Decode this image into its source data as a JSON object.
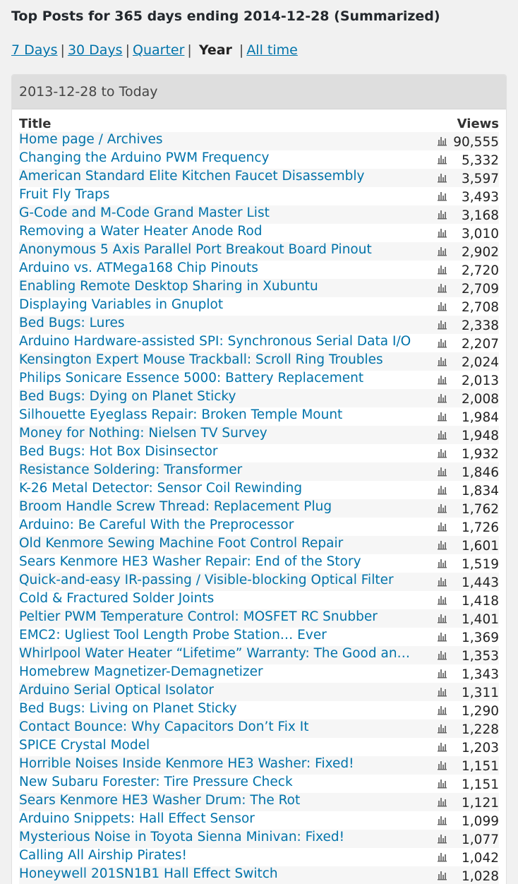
{
  "page_title": "Top Posts for 365 days ending 2014-12-28 (Summarized)",
  "period_nav": {
    "links": [
      "7 Days",
      "30 Days",
      "Quarter"
    ],
    "current": "Year",
    "all_time": "All time",
    "separator": "|"
  },
  "box": {
    "header": "2013-12-28 to Today",
    "col_title": "Title",
    "col_views": "Views"
  },
  "icons": {
    "stats": "bar-chart-icon"
  },
  "colors": {
    "link": "#0073aa",
    "header_bg": "#dedede",
    "row_alt": "#f6f6f6"
  },
  "posts": [
    {
      "title": "Home page / Archives",
      "views": "90,555"
    },
    {
      "title": "Changing the Arduino PWM Frequency",
      "views": "5,332"
    },
    {
      "title": "American Standard Elite Kitchen Faucet Disassembly",
      "views": "3,597"
    },
    {
      "title": "Fruit Fly Traps",
      "views": "3,493"
    },
    {
      "title": "G-Code and M-Code Grand Master List",
      "views": "3,168"
    },
    {
      "title": "Removing a Water Heater Anode Rod",
      "views": "3,010"
    },
    {
      "title": "Anonymous 5 Axis Parallel Port Breakout Board Pinout",
      "views": "2,902"
    },
    {
      "title": "Arduino vs. ATMega168 Chip Pinouts",
      "views": "2,720"
    },
    {
      "title": "Enabling Remote Desktop Sharing in Xubuntu",
      "views": "2,709"
    },
    {
      "title": "Displaying Variables in Gnuplot",
      "views": "2,708"
    },
    {
      "title": "Bed Bugs: Lures",
      "views": "2,338"
    },
    {
      "title": "Arduino Hardware-assisted SPI: Synchronous Serial Data I/O",
      "views": "2,207"
    },
    {
      "title": "Kensington Expert Mouse Trackball: Scroll Ring Troubles",
      "views": "2,024"
    },
    {
      "title": "Philips Sonicare Essence 5000: Battery Replacement",
      "views": "2,013"
    },
    {
      "title": "Bed Bugs: Dying on Planet Sticky",
      "views": "2,008"
    },
    {
      "title": "Silhouette Eyeglass Repair: Broken Temple Mount",
      "views": "1,984"
    },
    {
      "title": "Money for Nothing: Nielsen TV Survey",
      "views": "1,948"
    },
    {
      "title": "Bed Bugs: Hot Box Disinsector",
      "views": "1,932"
    },
    {
      "title": "Resistance Soldering: Transformer",
      "views": "1,846"
    },
    {
      "title": "K-26 Metal Detector: Sensor Coil Rewinding",
      "views": "1,834"
    },
    {
      "title": "Broom Handle Screw Thread: Replacement Plug",
      "views": "1,762"
    },
    {
      "title": "Arduino: Be Careful With the Preprocessor",
      "views": "1,726"
    },
    {
      "title": "Old Kenmore Sewing Machine Foot Control Repair",
      "views": "1,601"
    },
    {
      "title": "Sears Kenmore HE3 Washer Repair: End of the Story",
      "views": "1,519"
    },
    {
      "title": "Quick-and-easy IR-passing / Visible-blocking Optical Filter",
      "views": "1,443"
    },
    {
      "title": "Cold & Fractured Solder Joints",
      "views": "1,418"
    },
    {
      "title": "Peltier PWM Temperature Control: MOSFET RC Snubber",
      "views": "1,401"
    },
    {
      "title": "EMC2: Ugliest Tool Length Probe Station… Ever",
      "views": "1,369"
    },
    {
      "title": "Whirlpool Water Heater “Lifetime” Warranty: The Good an…",
      "views": "1,353"
    },
    {
      "title": "Homebrew Magnetizer-Demagnetizer",
      "views": "1,343"
    },
    {
      "title": "Arduino Serial Optical Isolator",
      "views": "1,311"
    },
    {
      "title": "Bed Bugs: Living on Planet Sticky",
      "views": "1,290"
    },
    {
      "title": "Contact Bounce: Why Capacitors Don’t Fix It",
      "views": "1,228"
    },
    {
      "title": "SPICE Crystal Model",
      "views": "1,203"
    },
    {
      "title": "Horrible Noises Inside Kenmore HE3 Washer: Fixed!",
      "views": "1,151"
    },
    {
      "title": "New Subaru Forester: Tire Pressure Check",
      "views": "1,151"
    },
    {
      "title": "Sears Kenmore HE3 Washer Drum: The Rot",
      "views": "1,121"
    },
    {
      "title": "Arduino Snippets: Hall Effect Sensor",
      "views": "1,099"
    },
    {
      "title": "Mysterious Noise in Toyota Sienna Minivan: Fixed!",
      "views": "1,077"
    },
    {
      "title": "Calling All Airship Pirates!",
      "views": "1,042"
    },
    {
      "title": "Honeywell 201SN1B1 Hall Effect Switch",
      "views": "1,028"
    }
  ]
}
